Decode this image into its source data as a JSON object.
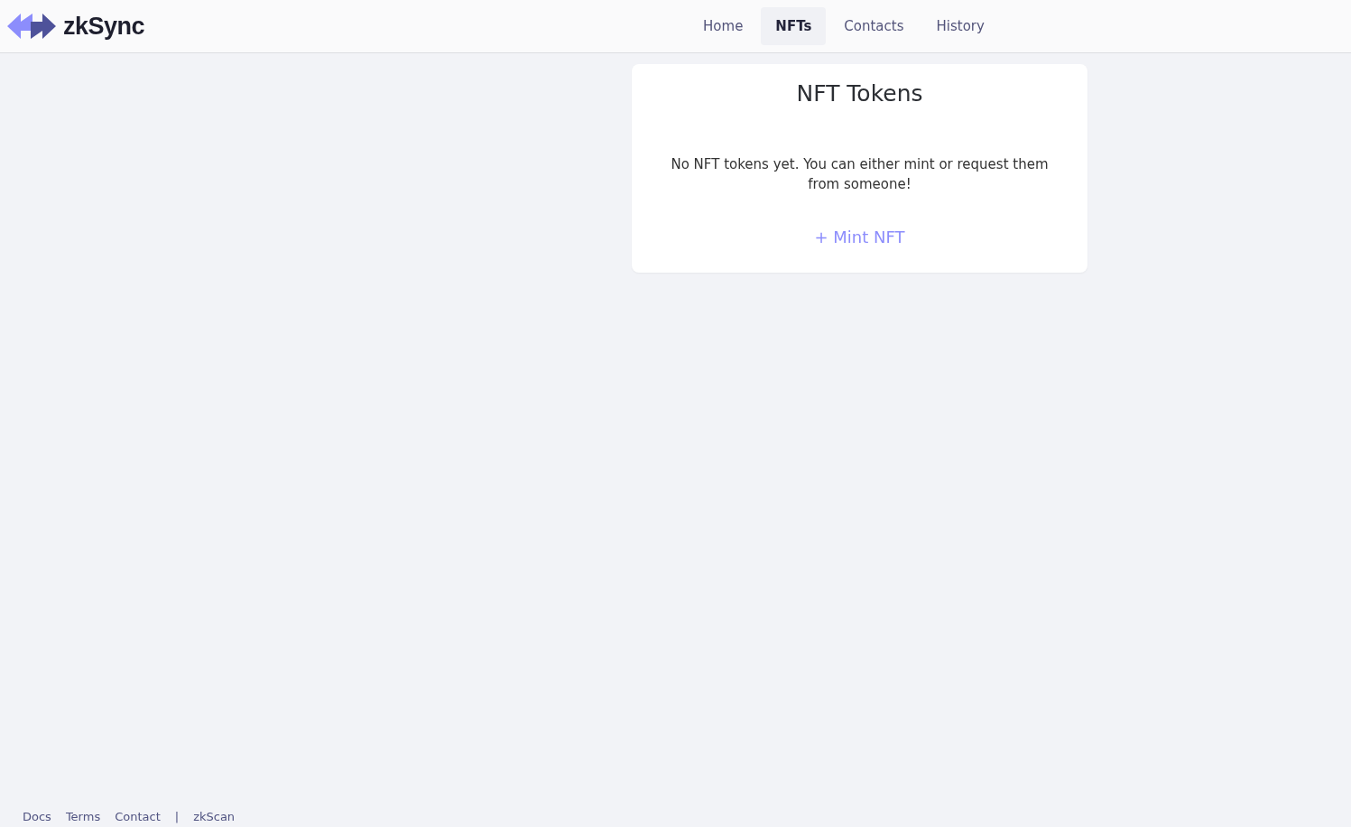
{
  "header": {
    "logo_text": "zkSync",
    "nav": [
      {
        "label": "Home",
        "selected": false
      },
      {
        "label": "NFTs",
        "selected": true
      },
      {
        "label": "Contacts",
        "selected": false
      },
      {
        "label": "History",
        "selected": false
      }
    ]
  },
  "card": {
    "title": "NFT Tokens",
    "message": "No NFT tokens yet. You can either mint or request them from someone!",
    "action": "+ Mint NFT"
  },
  "footer": {
    "links": [
      "Docs",
      "Terms",
      "Contact"
    ],
    "separator": "|",
    "extra_link": "zkScan"
  }
}
